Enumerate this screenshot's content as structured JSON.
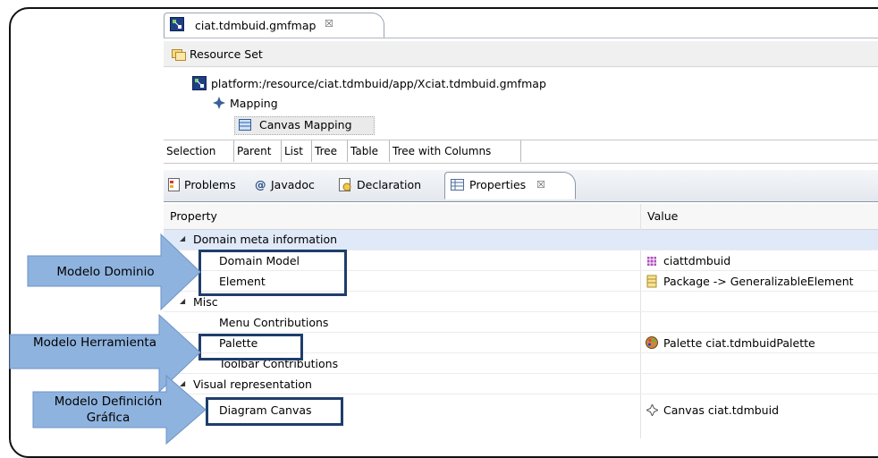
{
  "editor": {
    "tab_title": "ciat.tdmbuid.gmfmap",
    "tab_close": "☒",
    "resource_set": "Resource Set",
    "tree": {
      "root": "platform:/resource/ciat.tdmbuid/app/Xciat.tdmbuid.gmfmap",
      "mapping": "Mapping",
      "canvas_mapping": "Canvas Mapping"
    },
    "subtabs": [
      "Selection",
      "Parent",
      "List",
      "Tree",
      "Table",
      "Tree with Columns"
    ]
  },
  "views": {
    "tabs": [
      "Problems",
      "Javadoc",
      "Declaration",
      "Properties"
    ],
    "javadoc_glyph": "@",
    "close": "☒"
  },
  "properties": {
    "col_property": "Property",
    "col_value": "Value",
    "rows": [
      {
        "label": "Domain meta information",
        "value": "",
        "group": true
      },
      {
        "label": "Domain Model",
        "value": "ciattdmbuid"
      },
      {
        "label": "Element",
        "value": "Package -> GeneralizableElement"
      },
      {
        "label": "Misc",
        "value": "",
        "group": true
      },
      {
        "label": "Menu Contributions",
        "value": ""
      },
      {
        "label": "Palette",
        "value": "Palette ciat.tdmbuidPalette"
      },
      {
        "label": "Toolbar Contributions",
        "value": ""
      },
      {
        "label": "Visual representation",
        "value": "",
        "group": true
      },
      {
        "label": "Diagram Canvas",
        "value": "Canvas ciat.tdmbuid"
      }
    ],
    "expand_glyph": "◢"
  },
  "callouts": {
    "modelo_dominio": "Modelo Dominio",
    "modelo_herramienta": "Modelo Herramienta",
    "modelo_definicion_1": "Modelo Definición",
    "modelo_definicion_2": "Gráfica"
  },
  "colors": {
    "arrow": "#8fb3df",
    "box": "#1f3d6b",
    "selected_row": "#dfe9f8"
  }
}
